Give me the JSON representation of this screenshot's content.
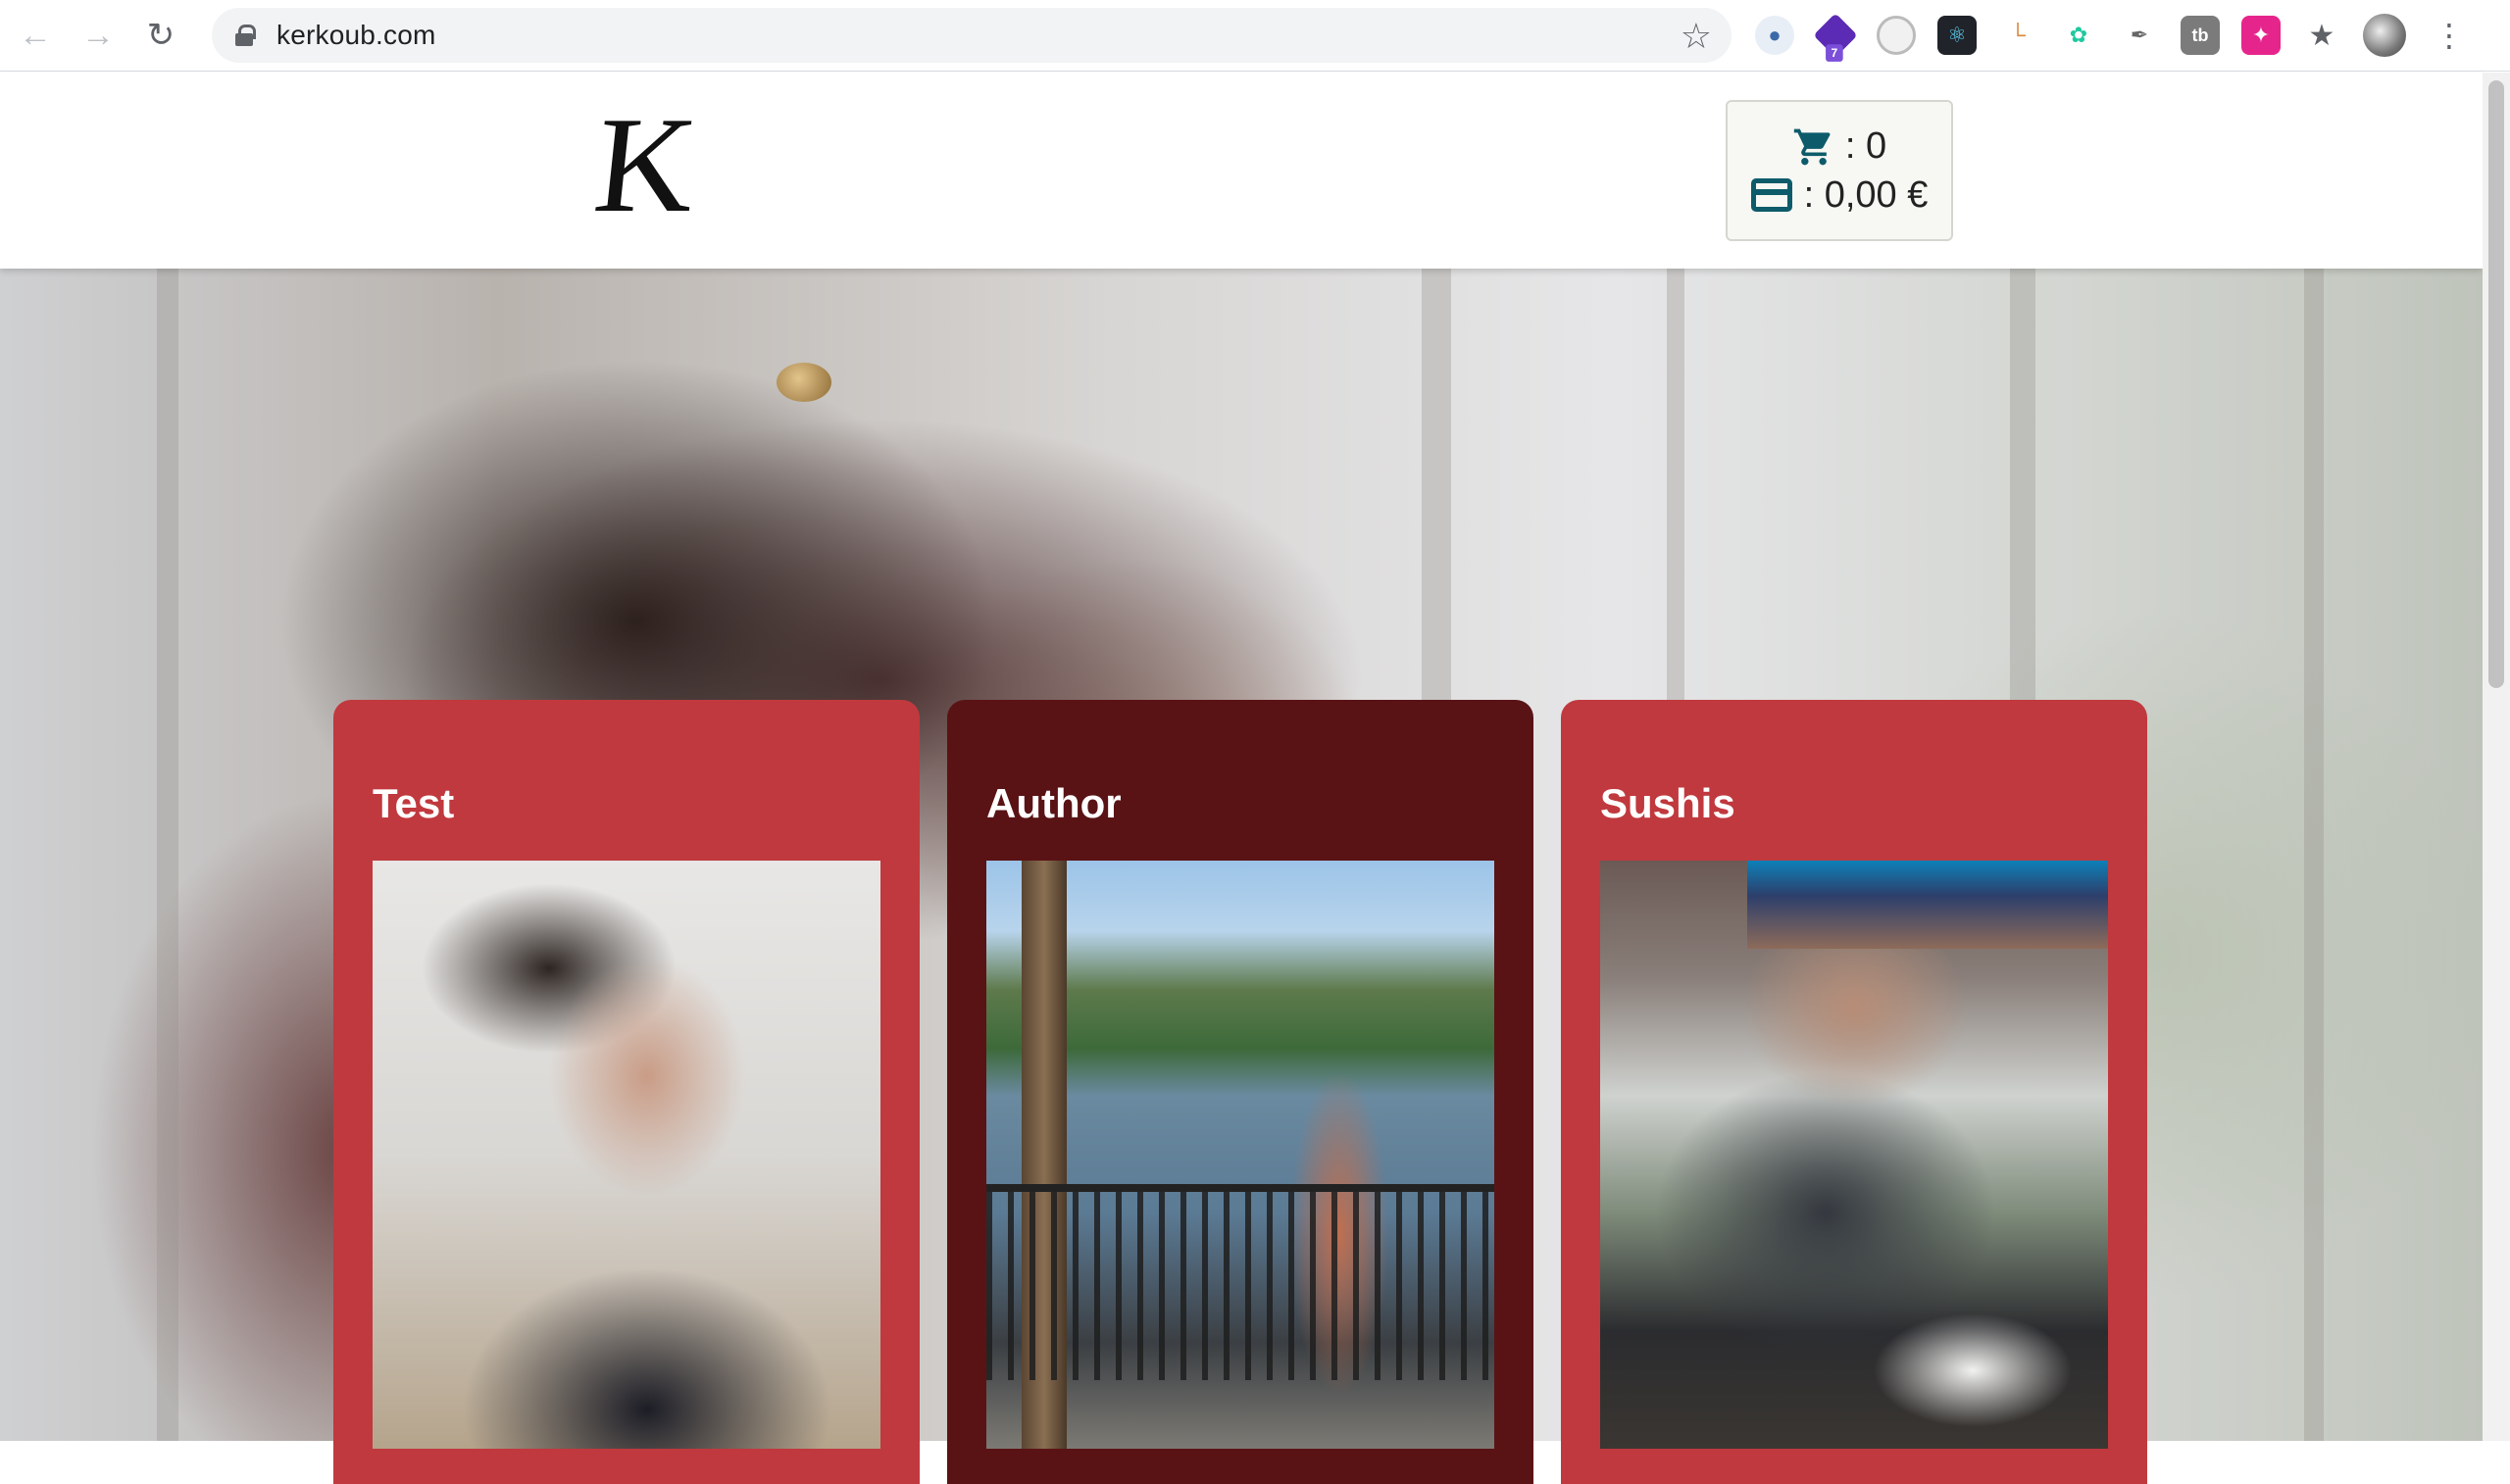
{
  "browser": {
    "url": "kerkoub.com",
    "extension_badge": "7"
  },
  "header": {
    "logo_letter": "K",
    "cart_count": ": 0",
    "cart_total": ": 0,00 €"
  },
  "cards": [
    {
      "title": "Test"
    },
    {
      "title": "Author"
    },
    {
      "title": "Sushis"
    }
  ],
  "colors": {
    "card_red": "#c0393e",
    "card_dark": "#5a1315",
    "icon_teal": "#0d5b6a"
  }
}
